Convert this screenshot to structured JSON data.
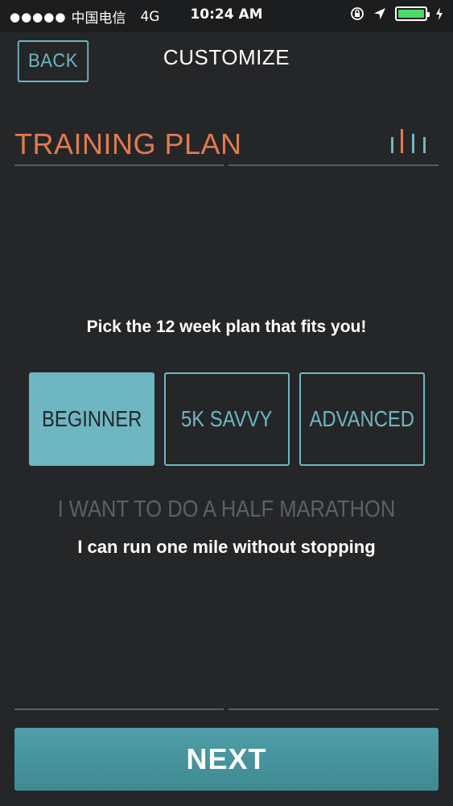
{
  "status_bar": {
    "signal": "●●●●●",
    "carrier": "中国电信",
    "network": "4G",
    "time": "10:24 AM",
    "icons": [
      "orientation-lock-icon",
      "location-arrow-icon",
      "battery-icon",
      "charging-bolt-icon"
    ],
    "battery_level": 1.0,
    "battery_color": "#4cd964"
  },
  "header": {
    "back_label": "BACK",
    "title": "CUSTOMIZE"
  },
  "section": {
    "title": "TRAINING PLAN",
    "icon": "bars-icon"
  },
  "plan": {
    "prompt": "Pick the 12 week plan that fits you!",
    "options": [
      {
        "label": "BEGINNER",
        "selected": true
      },
      {
        "label": "5K SAVVY",
        "selected": false
      },
      {
        "label": "ADVANCED",
        "selected": false
      }
    ],
    "goal": "I WANT TO DO A HALF MARATHON",
    "description": "I can run one mile without stopping"
  },
  "footer": {
    "next_label": "NEXT"
  },
  "colors": {
    "background": "#252628",
    "accent": "#6fb6c3",
    "title_orange": "#e27a4e",
    "next_button": "#4a97a1",
    "muted_text": "#5d6064"
  }
}
